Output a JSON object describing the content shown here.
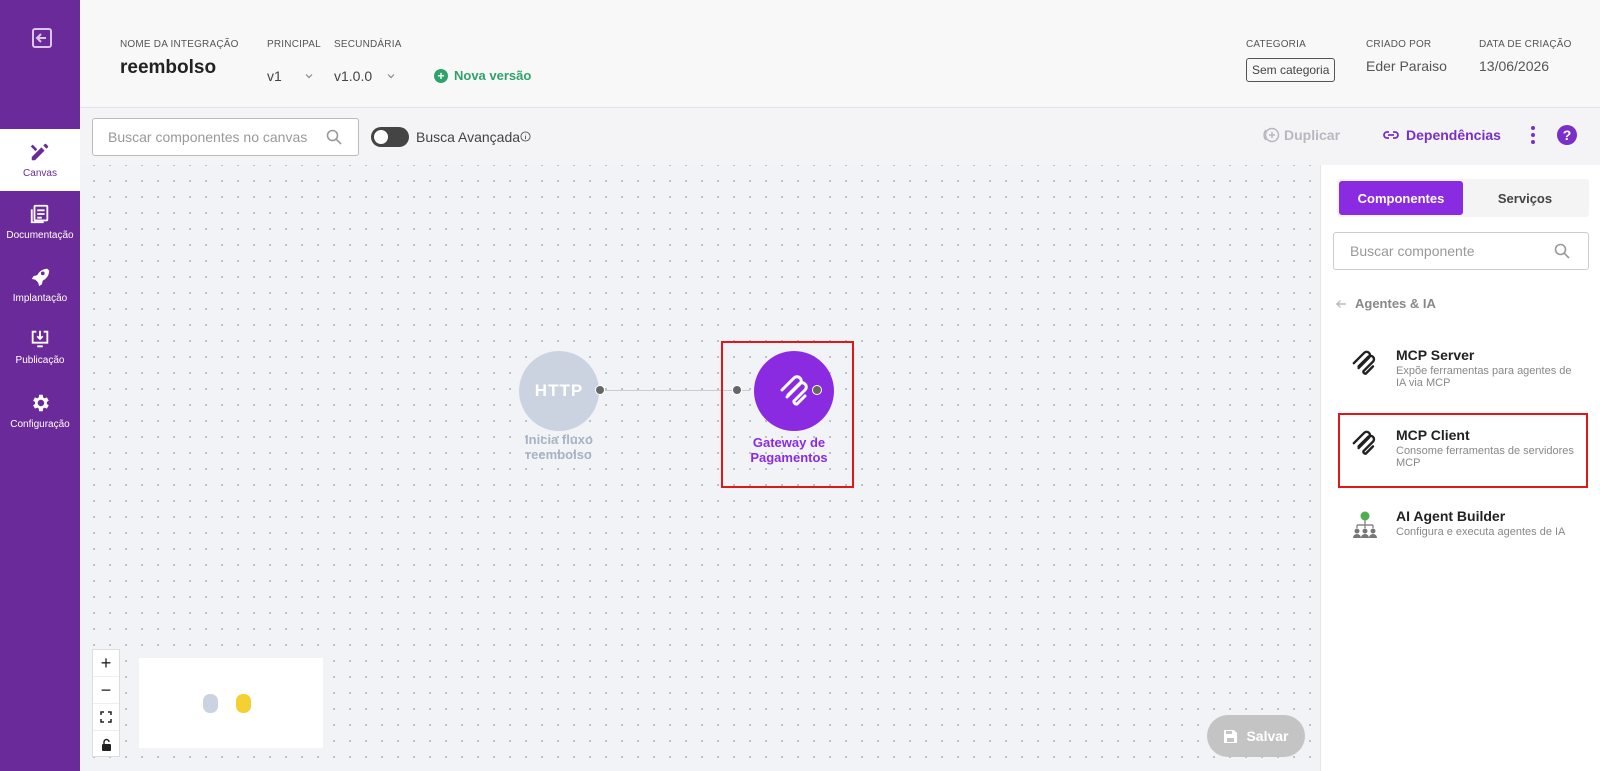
{
  "sidebar": {
    "items": [
      {
        "label": "Canvas",
        "icon": "canvas-icon"
      },
      {
        "label": "Documentação",
        "icon": "docs-icon"
      },
      {
        "label": "Implantação",
        "icon": "rocket-icon"
      },
      {
        "label": "Publicação",
        "icon": "publish-icon"
      },
      {
        "label": "Configuração",
        "icon": "gear-icon"
      }
    ]
  },
  "header": {
    "integration_name_label": "NOME DA INTEGRAÇÃO",
    "integration_name": "reembolso",
    "principal_label": "PRINCIPAL",
    "principal_value": "v1",
    "secundaria_label": "SECUNDÁRIA",
    "secundaria_value": "v1.0.0",
    "nova_versao": "Nova versão",
    "categoria_label": "CATEGORIA",
    "categoria_value": "Sem categoria",
    "criado_por_label": "CRIADO POR",
    "criado_por_value": "Eder Paraiso",
    "data_criacao_label": "DATA DE CRIAÇÃO",
    "data_criacao_value": "13/06/2026"
  },
  "toolbar": {
    "search_placeholder": "Buscar componentes no canvas",
    "advanced_search_label": "Busca Avançada",
    "duplicate_label": "Duplicar",
    "dependencies_label": "Dependências",
    "help_label": "?"
  },
  "canvas": {
    "nodes": [
      {
        "label": "HTTP",
        "caption_line1": "Inicia fluxo",
        "caption_line2": "reembolso"
      },
      {
        "label": "",
        "caption_line1": "Gateway de",
        "caption_line2": "Pagamentos"
      }
    ],
    "zoom_controls": [
      "+",
      "−"
    ],
    "save_label": "Salvar"
  },
  "panel": {
    "tabs": [
      {
        "label": "Componentes"
      },
      {
        "label": "Serviços"
      }
    ],
    "search_placeholder": "Buscar componente",
    "breadcrumb": "Agentes & IA",
    "components": [
      {
        "title": "MCP Server",
        "description": "Expõe ferramentas para agentes de IA via MCP",
        "icon": "mcp-icon"
      },
      {
        "title": "MCP Client",
        "description": "Consome ferramentas de servidores MCP",
        "icon": "mcp-icon"
      },
      {
        "title": "AI Agent Builder",
        "description": "Configura e executa agentes de IA",
        "icon": "ai-agent-icon"
      }
    ]
  },
  "colors": {
    "sidebar": "#6b2a9a",
    "accent": "#8a2be2",
    "success": "#2ea36b",
    "highlight": "#e01818"
  }
}
